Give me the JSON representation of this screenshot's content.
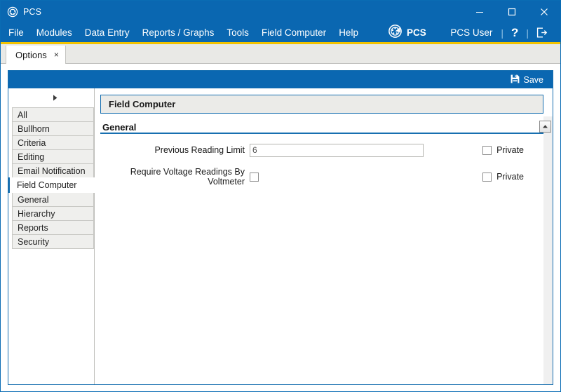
{
  "window": {
    "title": "PCS",
    "logo_icon": "pcs-logo-icon",
    "controls": {
      "minimize": "minimize-icon",
      "maximize": "maximize-icon",
      "close": "close-icon"
    }
  },
  "menu": {
    "items": [
      {
        "label": "File"
      },
      {
        "label": "Modules"
      },
      {
        "label": "Data Entry"
      },
      {
        "label": "Reports / Graphs"
      },
      {
        "label": "Tools"
      },
      {
        "label": "Field Computer"
      },
      {
        "label": "Help"
      }
    ],
    "brand": {
      "icon": "pcs-circle-icon",
      "label": "PCS"
    },
    "user": "PCS User",
    "separator": "|",
    "help_icon": "question-mark-icon",
    "help_glyph": "?",
    "logout_icon": "logout-icon",
    "accent_color": "#f3c300",
    "bar_color": "#0a67b1"
  },
  "tabs": [
    {
      "label": "Options",
      "close": "×",
      "active": true
    }
  ],
  "toolbar": {
    "save_label": "Save",
    "save_icon": "floppy-disk-icon"
  },
  "nav": {
    "expander_icon": "triangle-right-icon",
    "items": [
      {
        "label": "All",
        "selected": false
      },
      {
        "label": "Bullhorn",
        "selected": false
      },
      {
        "label": "Criteria",
        "selected": false
      },
      {
        "label": "Editing",
        "selected": false
      },
      {
        "label": "Email Notification",
        "selected": false
      },
      {
        "label": "Field Computer",
        "selected": true
      },
      {
        "label": "General",
        "selected": false
      },
      {
        "label": "Hierarchy",
        "selected": false
      },
      {
        "label": "Reports",
        "selected": false
      },
      {
        "label": "Security",
        "selected": false
      }
    ]
  },
  "panel": {
    "title": "Field Computer",
    "section": {
      "label": "General",
      "collapse_icon": "chevron-up-icon",
      "underline_color": "#176fb0"
    },
    "fields": [
      {
        "label": "Previous Reading Limit",
        "type": "text",
        "value": "6",
        "private_label": "Private",
        "private_checked": false
      },
      {
        "label": "Require Voltage Readings By Voltmeter",
        "type": "checkbox",
        "checked": false,
        "private_label": "Private",
        "private_checked": false
      }
    ]
  }
}
